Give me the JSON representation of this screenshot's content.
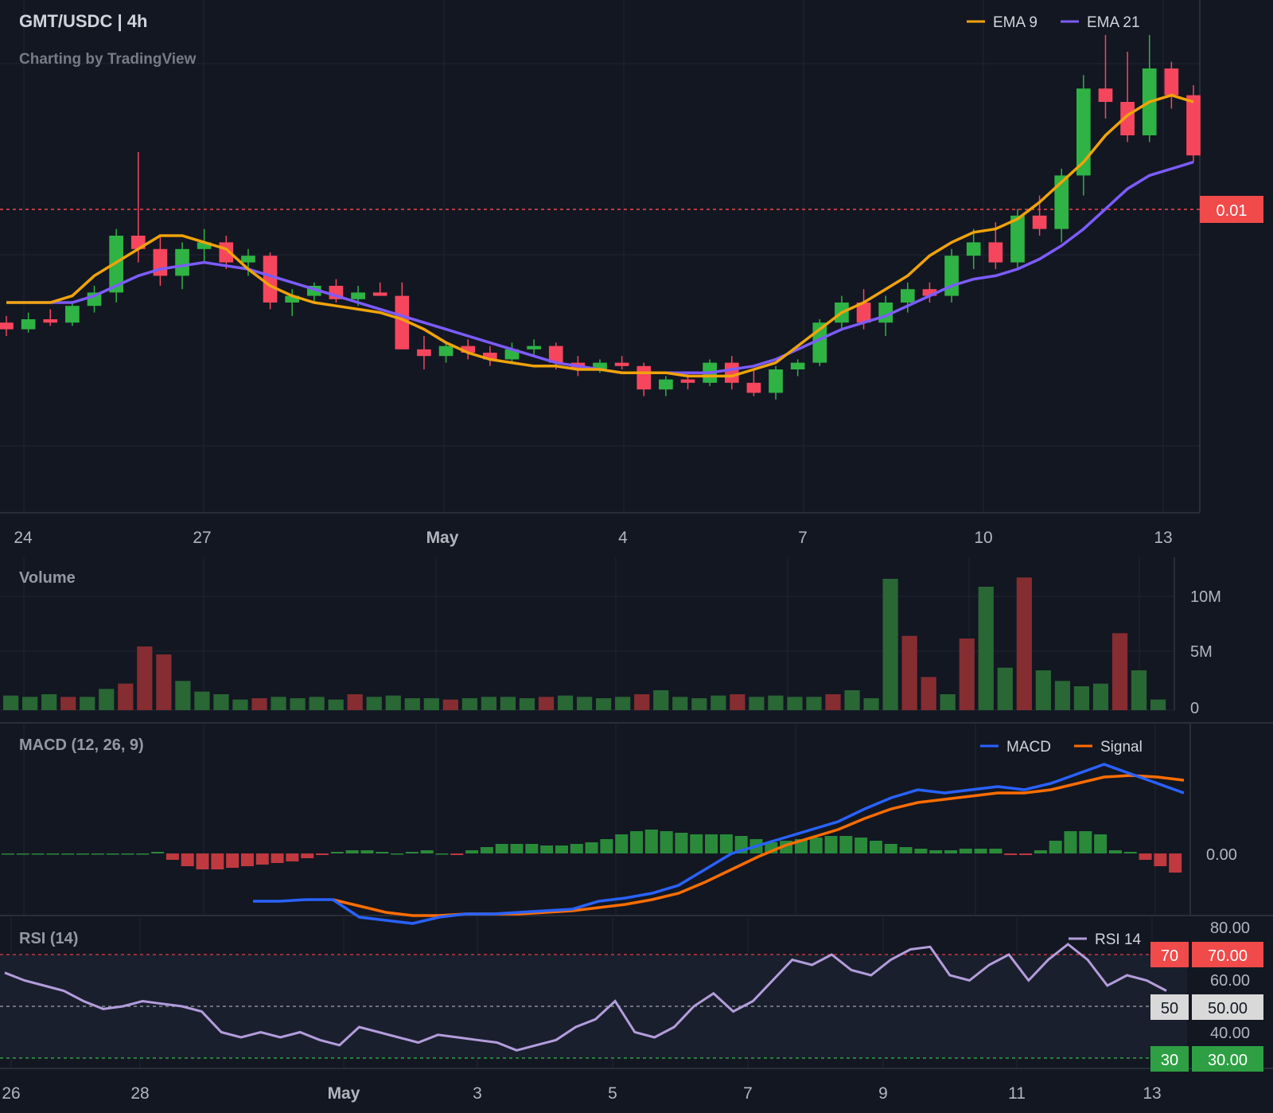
{
  "header": {
    "symbol_title": "GMT/USDC | 4h",
    "attribution": "Charting by TradingView"
  },
  "legend": {
    "ema9_label": "EMA 9",
    "ema21_label": "EMA 21",
    "macd_label": "MACD",
    "signal_label": "Signal",
    "rsi_label": "RSI 14"
  },
  "panes": {
    "volume_title": "Volume",
    "macd_title": "MACD (12, 26, 9)",
    "rsi_title": "RSI (14)"
  },
  "price_pane": {
    "current_price_label": "0.01",
    "x_axis_ticks": [
      "24",
      "27",
      "May",
      "4",
      "7",
      "10",
      "13"
    ]
  },
  "volume_pane": {
    "y_axis_ticks": [
      "10M",
      "5M",
      "0"
    ]
  },
  "macd_pane": {
    "y_axis_ticks": [
      "0.00"
    ]
  },
  "rsi_pane": {
    "y_axis_ticks": [
      "80.00",
      "70.00",
      "60.00",
      "50.00",
      "40.00",
      "30.00"
    ],
    "level_badges": [
      "70",
      "50",
      "30"
    ],
    "x_axis_ticks": [
      "26",
      "28",
      "May",
      "3",
      "5",
      "7",
      "9",
      "11",
      "13"
    ]
  },
  "colors": {
    "background": "#131722",
    "up": "#26a69a",
    "up_candle": "#2fb344",
    "down_candle": "#f6465d",
    "ema9": "#f0a30a",
    "ema21": "#7c5cfc",
    "macd": "#2962ff",
    "signal": "#ff6d00",
    "rsi": "#b39ddb",
    "grid": "#1f2433",
    "price_badge": "#f04a4a",
    "rsi_70": "#f04a4a",
    "rsi_50": "#d9d9d9",
    "rsi_30": "#2ea043"
  },
  "chart_data": [
    {
      "type": "candlestick",
      "title": "GMT/USDC | 4h",
      "current_price": "0.01",
      "ema9": [
        0.5,
        0.5,
        0.5,
        0.52,
        0.58,
        0.62,
        0.66,
        0.7,
        0.7,
        0.68,
        0.66,
        0.6,
        0.55,
        0.52,
        0.5,
        0.49,
        0.48,
        0.47,
        0.45,
        0.42,
        0.38,
        0.35,
        0.33,
        0.32,
        0.31,
        0.31,
        0.3,
        0.3,
        0.29,
        0.29,
        0.29,
        0.28,
        0.28,
        0.28,
        0.3,
        0.32,
        0.37,
        0.42,
        0.47,
        0.5,
        0.54,
        0.58,
        0.64,
        0.68,
        0.71,
        0.72,
        0.75,
        0.8,
        0.86,
        0.92,
        1.0,
        1.06,
        1.1,
        1.12,
        1.1
      ],
      "ema21": [
        0.5,
        0.5,
        0.5,
        0.5,
        0.52,
        0.55,
        0.58,
        0.6,
        0.61,
        0.62,
        0.61,
        0.6,
        0.58,
        0.56,
        0.54,
        0.52,
        0.5,
        0.48,
        0.46,
        0.44,
        0.42,
        0.4,
        0.38,
        0.36,
        0.34,
        0.32,
        0.31,
        0.3,
        0.29,
        0.29,
        0.29,
        0.29,
        0.29,
        0.3,
        0.31,
        0.33,
        0.36,
        0.39,
        0.42,
        0.44,
        0.46,
        0.49,
        0.52,
        0.55,
        0.57,
        0.58,
        0.6,
        0.63,
        0.67,
        0.72,
        0.78,
        0.84,
        0.88,
        0.9,
        0.92
      ],
      "candles": [
        [
          0.44,
          0.46,
          0.4,
          0.42
        ],
        [
          0.42,
          0.47,
          0.41,
          0.45
        ],
        [
          0.45,
          0.48,
          0.43,
          0.44
        ],
        [
          0.44,
          0.5,
          0.43,
          0.49
        ],
        [
          0.49,
          0.55,
          0.47,
          0.53
        ],
        [
          0.53,
          0.72,
          0.5,
          0.7
        ],
        [
          0.7,
          0.95,
          0.62,
          0.66
        ],
        [
          0.66,
          0.7,
          0.55,
          0.58
        ],
        [
          0.58,
          0.68,
          0.54,
          0.66
        ],
        [
          0.66,
          0.72,
          0.62,
          0.68
        ],
        [
          0.68,
          0.7,
          0.6,
          0.62
        ],
        [
          0.62,
          0.66,
          0.58,
          0.64
        ],
        [
          0.64,
          0.65,
          0.48,
          0.5
        ],
        [
          0.5,
          0.54,
          0.46,
          0.52
        ],
        [
          0.52,
          0.56,
          0.5,
          0.55
        ],
        [
          0.55,
          0.57,
          0.5,
          0.51
        ],
        [
          0.51,
          0.55,
          0.49,
          0.53
        ],
        [
          0.53,
          0.56,
          0.52,
          0.52
        ],
        [
          0.52,
          0.56,
          0.48,
          0.36
        ],
        [
          0.36,
          0.4,
          0.3,
          0.34
        ],
        [
          0.34,
          0.38,
          0.32,
          0.37
        ],
        [
          0.37,
          0.39,
          0.33,
          0.35
        ],
        [
          0.35,
          0.37,
          0.31,
          0.33
        ],
        [
          0.33,
          0.38,
          0.32,
          0.36
        ],
        [
          0.36,
          0.39,
          0.34,
          0.37
        ],
        [
          0.37,
          0.38,
          0.3,
          0.32
        ],
        [
          0.32,
          0.34,
          0.28,
          0.3
        ],
        [
          0.3,
          0.33,
          0.29,
          0.32
        ],
        [
          0.32,
          0.34,
          0.3,
          0.31
        ],
        [
          0.31,
          0.32,
          0.22,
          0.24
        ],
        [
          0.24,
          0.28,
          0.22,
          0.27
        ],
        [
          0.27,
          0.29,
          0.24,
          0.26
        ],
        [
          0.26,
          0.33,
          0.25,
          0.32
        ],
        [
          0.32,
          0.34,
          0.24,
          0.26
        ],
        [
          0.26,
          0.3,
          0.22,
          0.23
        ],
        [
          0.23,
          0.31,
          0.21,
          0.3
        ],
        [
          0.3,
          0.33,
          0.28,
          0.32
        ],
        [
          0.32,
          0.45,
          0.31,
          0.44
        ],
        [
          0.44,
          0.52,
          0.42,
          0.5
        ],
        [
          0.5,
          0.54,
          0.42,
          0.44
        ],
        [
          0.44,
          0.52,
          0.4,
          0.5
        ],
        [
          0.5,
          0.56,
          0.47,
          0.54
        ],
        [
          0.54,
          0.56,
          0.5,
          0.52
        ],
        [
          0.52,
          0.66,
          0.5,
          0.64
        ],
        [
          0.64,
          0.72,
          0.6,
          0.68
        ],
        [
          0.68,
          0.74,
          0.6,
          0.62
        ],
        [
          0.62,
          0.78,
          0.6,
          0.76
        ],
        [
          0.76,
          0.82,
          0.7,
          0.72
        ],
        [
          0.72,
          0.9,
          0.68,
          0.88
        ],
        [
          0.88,
          1.18,
          0.82,
          1.14
        ],
        [
          1.14,
          1.3,
          1.05,
          1.1
        ],
        [
          1.1,
          1.25,
          0.98,
          1.0
        ],
        [
          1.0,
          1.3,
          0.98,
          1.2
        ],
        [
          1.2,
          1.22,
          1.08,
          1.12
        ],
        [
          1.12,
          1.15,
          0.92,
          0.94
        ]
      ]
    },
    {
      "type": "bar",
      "title": "Volume",
      "ylim": [
        0,
        12000000
      ],
      "values": [
        1.1,
        1.0,
        1.2,
        1.0,
        1.0,
        1.6,
        2.0,
        4.8,
        4.2,
        2.2,
        1.4,
        1.2,
        0.8,
        0.9,
        1.0,
        0.9,
        1.0,
        0.8,
        1.2,
        1.0,
        1.1,
        0.9,
        0.9,
        0.8,
        0.9,
        1.0,
        1.0,
        0.9,
        1.0,
        1.1,
        1.0,
        0.9,
        1.0,
        1.2,
        1.5,
        1.0,
        0.9,
        1.1,
        1.2,
        1.0,
        1.1,
        1.0,
        1.0,
        1.2,
        1.5,
        0.9,
        9.9,
        5.6,
        2.5,
        1.2,
        5.4,
        9.3,
        3.2,
        10.0,
        3.0,
        2.2,
        1.8,
        2.0,
        5.8,
        3.0,
        0.8
      ]
    },
    {
      "type": "line",
      "title": "MACD (12, 26, 9)",
      "series": [
        {
          "name": "MACD",
          "values": [
            -0.3,
            -0.3,
            -0.29,
            -0.29,
            -0.4,
            -0.42,
            -0.44,
            -0.4,
            -0.38,
            -0.38,
            -0.37,
            -0.36,
            -0.35,
            -0.3,
            -0.28,
            -0.25,
            -0.2,
            -0.1,
            0.0,
            0.05,
            0.1,
            0.15,
            0.2,
            0.28,
            0.35,
            0.4,
            0.38,
            0.4,
            0.42,
            0.4,
            0.44,
            0.5,
            0.56,
            0.5,
            0.44,
            0.38
          ]
        },
        {
          "name": "Signal",
          "values": [
            null,
            null,
            null,
            -0.29,
            -0.33,
            -0.37,
            -0.39,
            -0.39,
            -0.38,
            -0.38,
            -0.38,
            -0.37,
            -0.36,
            -0.34,
            -0.32,
            -0.29,
            -0.25,
            -0.18,
            -0.1,
            -0.02,
            0.05,
            0.1,
            0.15,
            0.22,
            0.28,
            0.32,
            0.34,
            0.36,
            0.38,
            0.38,
            0.4,
            0.44,
            0.48,
            0.49,
            0.48,
            0.46
          ]
        }
      ],
      "histogram": [
        0,
        0,
        0,
        0,
        0,
        0,
        0,
        0,
        0,
        0,
        0.005,
        -0.02,
        -0.04,
        -0.05,
        -0.05,
        -0.045,
        -0.04,
        -0.035,
        -0.03,
        -0.025,
        -0.015,
        -0.005,
        0.005,
        0.01,
        0.01,
        0.005,
        0,
        0.005,
        0.01,
        0.0,
        -0.005,
        0.01,
        0.02,
        0.03,
        0.03,
        0.03,
        0.025,
        0.025,
        0.03,
        0.035,
        0.045,
        0.06,
        0.07,
        0.075,
        0.07,
        0.065,
        0.06,
        0.06,
        0.06,
        0.055,
        0.045,
        0.035,
        0.04,
        0.045,
        0.05,
        0.055,
        0.055,
        0.05,
        0.04,
        0.03,
        0.02,
        0.015,
        0.01,
        0.01,
        0.015,
        0.015,
        0.015,
        -0.005,
        -0.005,
        0.01,
        0.04,
        0.07,
        0.07,
        0.06,
        0.01,
        0.005,
        -0.02,
        -0.04,
        -0.06
      ]
    },
    {
      "type": "line",
      "title": "RSI (14)",
      "ylim": [
        25,
        85
      ],
      "levels": [
        70,
        50,
        30
      ],
      "series": [
        {
          "name": "RSI 14",
          "values": [
            63,
            60,
            58,
            56,
            52,
            49,
            50,
            52,
            51,
            50,
            48,
            40,
            38,
            40,
            38,
            40,
            37,
            35,
            42,
            40,
            38,
            36,
            39,
            38,
            37,
            36,
            33,
            35,
            37,
            42,
            45,
            52,
            40,
            38,
            42,
            50,
            55,
            48,
            52,
            60,
            68,
            66,
            70,
            64,
            62,
            68,
            72,
            73,
            62,
            60,
            66,
            70,
            60,
            68,
            74,
            68,
            58,
            62,
            60,
            56
          ]
        }
      ]
    }
  ]
}
